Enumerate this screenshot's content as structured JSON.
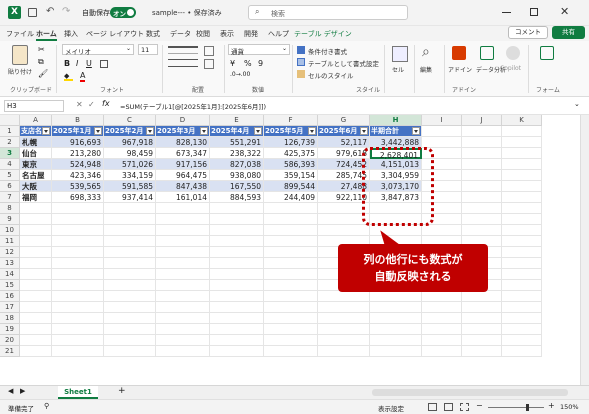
{
  "titlebar": {
    "autosave_label": "自動保存",
    "autosave_state": "オン",
    "doc_title": "sample--- • 保存済み",
    "search_placeholder": "検索"
  },
  "tabs": [
    "ファイル",
    "ホーム",
    "挿入",
    "ページ レイアウト",
    "数式",
    "データ",
    "校閲",
    "表示",
    "開発",
    "ヘルプ",
    "テーブル デザイン"
  ],
  "comment_label": "コメント",
  "share_label": "共有",
  "ribbon": {
    "paste": "貼り付け",
    "clipboard": "クリップボード",
    "font_name": "メイリオ",
    "font_size": "11",
    "font_group": "フォント",
    "align_group": "配置",
    "number_format": "通貨",
    "number_group": "数値",
    "cond_format": "条件付き書式",
    "table_format": "テーブルとして書式設定",
    "cell_style": "セルのスタイル",
    "style_group": "スタイル",
    "cells": "セル",
    "edit": "編集",
    "addins": "アドイン",
    "addins_group": "アドイン",
    "data_analysis": "データ分析",
    "copilot": "Copilot",
    "forms": "フォーム"
  },
  "formula_bar": {
    "name_box": "H3",
    "fx": "fx",
    "formula": "=SUM(テーブル1[@[2025年1月]:[2025年6月]])"
  },
  "columns": [
    "A",
    "B",
    "C",
    "D",
    "E",
    "F",
    "G",
    "H",
    "I",
    "J",
    "K",
    "L"
  ],
  "rows": [
    "1",
    "2",
    "3",
    "4",
    "5",
    "6",
    "7",
    "8",
    "9",
    "10",
    "11",
    "12",
    "13",
    "14",
    "15",
    "16",
    "17",
    "18",
    "19",
    "20",
    "21"
  ],
  "table": {
    "headers": [
      "支店名",
      "2025年1月",
      "2025年2月",
      "2025年3月",
      "2025年4月",
      "2025年5月",
      "2025年6月",
      "半期合計"
    ],
    "rows": [
      [
        "札幌",
        "916,693",
        "967,918",
        "828,130",
        "551,291",
        "126,739",
        "52,117",
        "3,442,888"
      ],
      [
        "仙台",
        "213,280",
        "98,459",
        "673,347",
        "238,322",
        "425,375",
        "979,618",
        "2,628,401"
      ],
      [
        "東京",
        "524,948",
        "571,026",
        "917,156",
        "827,038",
        "586,393",
        "724,452",
        "4,151,013"
      ],
      [
        "名古屋",
        "423,346",
        "334,159",
        "964,475",
        "938,080",
        "359,154",
        "285,745",
        "3,304,959"
      ],
      [
        "大阪",
        "539,565",
        "591,585",
        "847,438",
        "167,550",
        "899,544",
        "27,488",
        "3,073,170"
      ],
      [
        "福岡",
        "698,333",
        "937,414",
        "161,014",
        "884,593",
        "244,409",
        "922,110",
        "3,847,873"
      ]
    ]
  },
  "callout": {
    "line1": "列の他行にも数式が",
    "line2": "自動反映される"
  },
  "sheet_tab": "Sheet1",
  "status": {
    "ready": "準備完了",
    "display_settings": "表示設定",
    "zoom": "150%"
  },
  "colors": {
    "accent": "#107c41",
    "header": "#4472c4",
    "band": "#d9e1f2",
    "callout": "#c00000"
  }
}
